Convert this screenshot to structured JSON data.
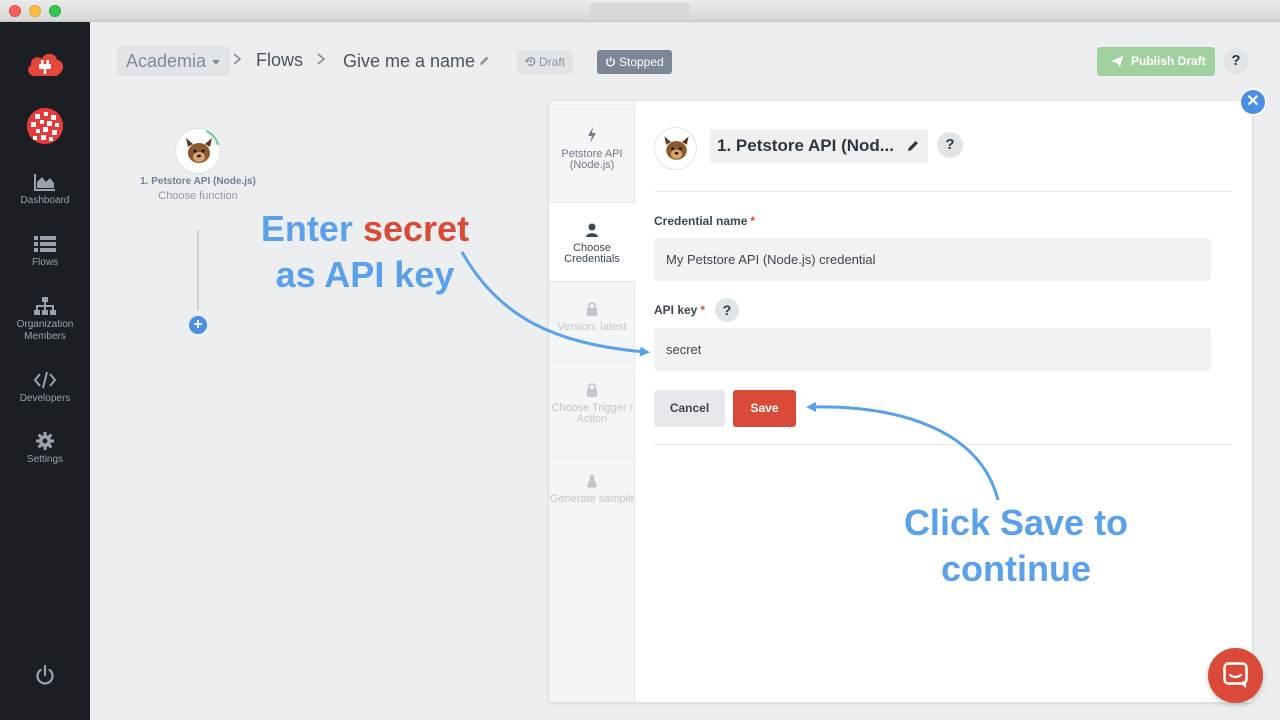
{
  "colors": {
    "sidebar": "#1b1e22",
    "accent_blue": "#4b8fe0",
    "save_red": "#d94a38",
    "publish_green": "#9fd19f",
    "callout_blue": "#5aa0ea"
  },
  "sidebar": {
    "items": [
      {
        "label": "Dashboard",
        "icon": "area-chart-icon"
      },
      {
        "label": "Flows",
        "icon": "list-icon"
      },
      {
        "label": "Organization Members",
        "icon": "sitemap-icon"
      },
      {
        "label": "Developers",
        "icon": "code-icon"
      },
      {
        "label": "Settings",
        "icon": "gear-icon"
      }
    ]
  },
  "header": {
    "workspace": "Academia",
    "flows": "Flows",
    "flow_name": "Give me a name",
    "draft_badge": "Draft",
    "stopped_badge": "Stopped",
    "publish_button": "Publish Draft",
    "help": "?"
  },
  "canvas": {
    "node_title": "1. Petstore API (Node.js)",
    "node_subtitle": "Choose function",
    "add_symbol": "+"
  },
  "panel": {
    "steps": [
      {
        "label": "Petstore API (Node.js)",
        "icon": "bolt-icon",
        "state": "done"
      },
      {
        "label": "Choose Credentials",
        "icon": "user-icon",
        "state": "active"
      },
      {
        "label": "Version: latest",
        "icon": "lock-icon",
        "state": "disabled"
      },
      {
        "label": "Choose Trigger / Action",
        "icon": "lock-icon",
        "state": "disabled"
      },
      {
        "label": "Generate sample",
        "icon": "flask-icon",
        "state": "disabled"
      }
    ],
    "title": "1. Petstore API (Nod...",
    "help": "?",
    "credential_name_label": "Credential name",
    "credential_name_value": "My Petstore API (Node.js) credential",
    "api_key_label": "API key",
    "api_key_value": "secret",
    "required_mark": "*",
    "cancel_button": "Cancel",
    "save_button": "Save",
    "close_symbol": "✕"
  },
  "annotations": {
    "enter_prefix": "Enter",
    "enter_highlight": "secret",
    "enter_suffix": "as API key",
    "click_line1": "Click Save to",
    "click_line2": "continue"
  }
}
